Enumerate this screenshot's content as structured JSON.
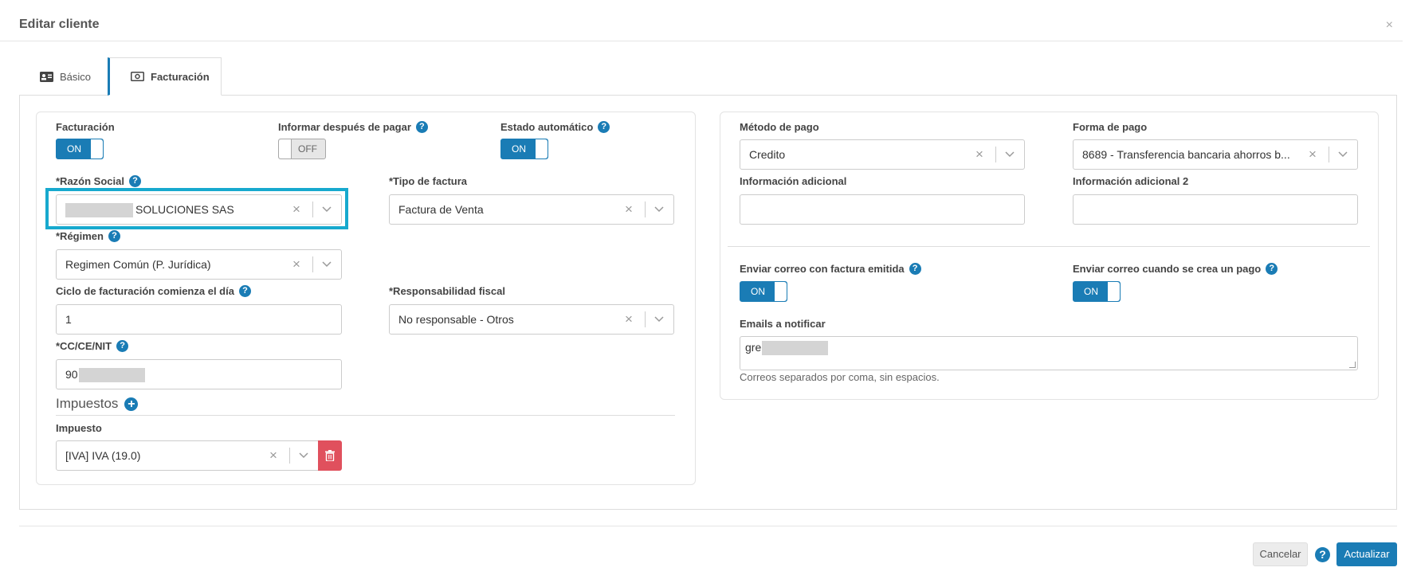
{
  "dialog": {
    "title": "Editar cliente",
    "close_label": "×"
  },
  "tabs": [
    {
      "label": "Básico",
      "icon": "id-card-icon"
    },
    {
      "label": "Facturación",
      "icon": "money-bill-icon"
    }
  ],
  "left": {
    "facturacion": {
      "label": "Facturación",
      "state": "ON"
    },
    "informar": {
      "label": "Informar después de pagar",
      "state": "OFF"
    },
    "estado_auto": {
      "label": "Estado automático",
      "state": "ON"
    },
    "razon_social": {
      "label": "*Razón Social",
      "value": "SOLUCIONES SAS"
    },
    "tipo_factura": {
      "label": "*Tipo de factura",
      "value": "Factura de Venta"
    },
    "regimen": {
      "label": "*Régimen",
      "value": "Regimen Común (P. Jurídica)"
    },
    "ciclo": {
      "label": "Ciclo de facturación comienza el día",
      "value": "1"
    },
    "responsabilidad": {
      "label": "*Responsabilidad fiscal",
      "value": "No responsable - Otros"
    },
    "nit": {
      "label": "*CC/CE/NIT",
      "value": "90"
    },
    "impuestos": {
      "heading": "Impuestos",
      "impuesto_label": "Impuesto",
      "impuesto_value": "[IVA] IVA (19.0)"
    }
  },
  "right": {
    "metodo_pago": {
      "label": "Método de pago",
      "value": "Credito"
    },
    "forma_pago": {
      "label": "Forma de pago",
      "value": "8689 - Transferencia bancaria ahorros b..."
    },
    "info_adicional": {
      "label": "Información adicional",
      "value": ""
    },
    "info_adicional2": {
      "label": "Información adicional 2",
      "value": ""
    },
    "correo_factura": {
      "label": "Enviar correo con factura emitida",
      "state": "ON"
    },
    "correo_pago": {
      "label": "Enviar correo cuando se crea un pago",
      "state": "ON"
    },
    "emails": {
      "label": "Emails a notificar",
      "value": "gre",
      "hint": "Correos separados por coma, sin espacios."
    }
  },
  "footer": {
    "cancel": "Cancelar",
    "help": "?",
    "update": "Actualizar"
  },
  "help_glyph": "?",
  "clear_glyph": "×",
  "colors": {
    "primary": "#1a7cb5",
    "danger": "#e0505d",
    "highlight": "#17a9ce"
  }
}
